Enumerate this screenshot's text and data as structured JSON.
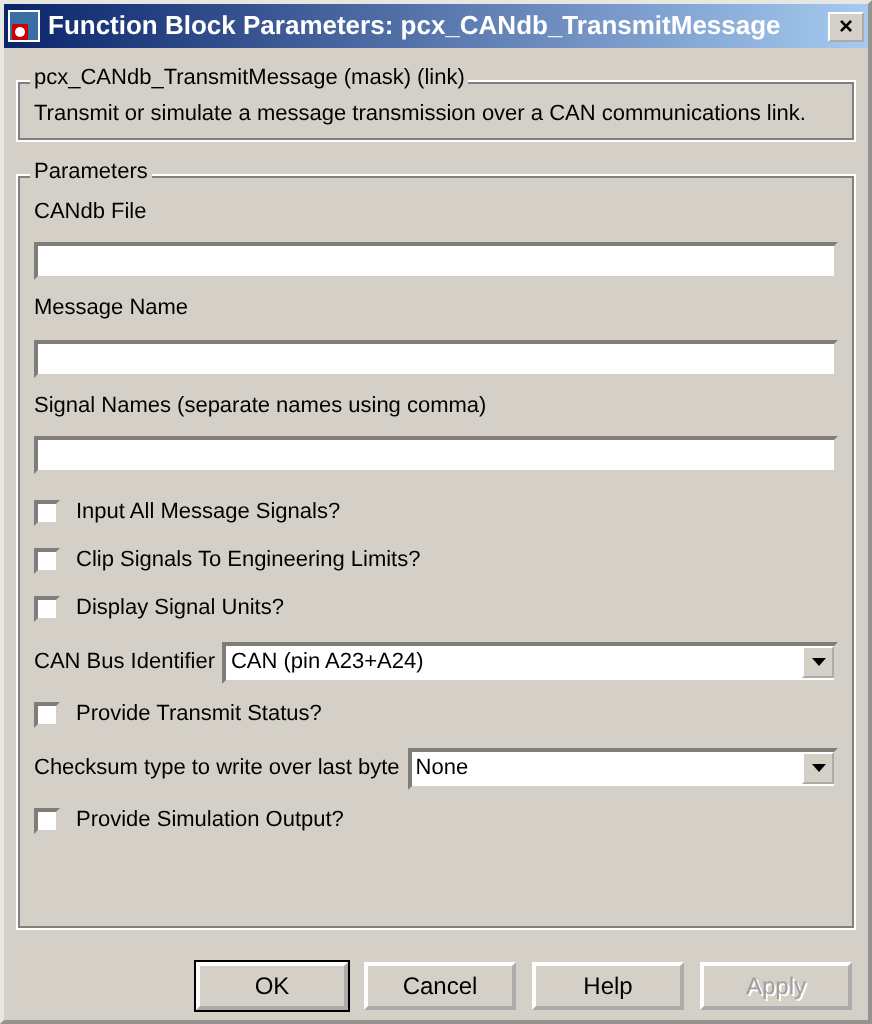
{
  "window": {
    "title": "Function Block Parameters: pcx_CANdb_TransmitMessage",
    "close": "×"
  },
  "description": {
    "legend": "pcx_CANdb_TransmitMessage (mask) (link)",
    "text": "Transmit or simulate a message transmission over a CAN communications link."
  },
  "parameters": {
    "legend": "Parameters",
    "fields": [
      {
        "kind": "text",
        "label": "CANdb File"
      },
      {
        "kind": "text",
        "label": "Message Name"
      },
      {
        "kind": "text",
        "label": "Signal Names (separate names using comma)"
      },
      {
        "kind": "checkbox",
        "label": "Input All Message Signals?",
        "checked": false
      },
      {
        "kind": "checkbox",
        "label": "Clip Signals To Engineering Limits?",
        "checked": false
      },
      {
        "kind": "checkbox",
        "label": "Display Signal Units?",
        "checked": false
      },
      {
        "kind": "select",
        "label": "CAN Bus Identifier",
        "value": "CAN (pin A23+A24)"
      },
      {
        "kind": "checkbox",
        "label": "Provide Transmit Status?",
        "checked": false
      },
      {
        "kind": "select",
        "label": "Checksum type to write over last byte",
        "value": "None"
      },
      {
        "kind": "checkbox",
        "label": "Provide Simulation Output?",
        "checked": false
      }
    ]
  },
  "buttons": [
    {
      "label": "OK",
      "disabled": false,
      "default": true
    },
    {
      "label": "Cancel",
      "disabled": false,
      "default": false
    },
    {
      "label": "Help",
      "disabled": false,
      "default": false
    },
    {
      "label": "Apply",
      "disabled": true,
      "default": false
    }
  ]
}
